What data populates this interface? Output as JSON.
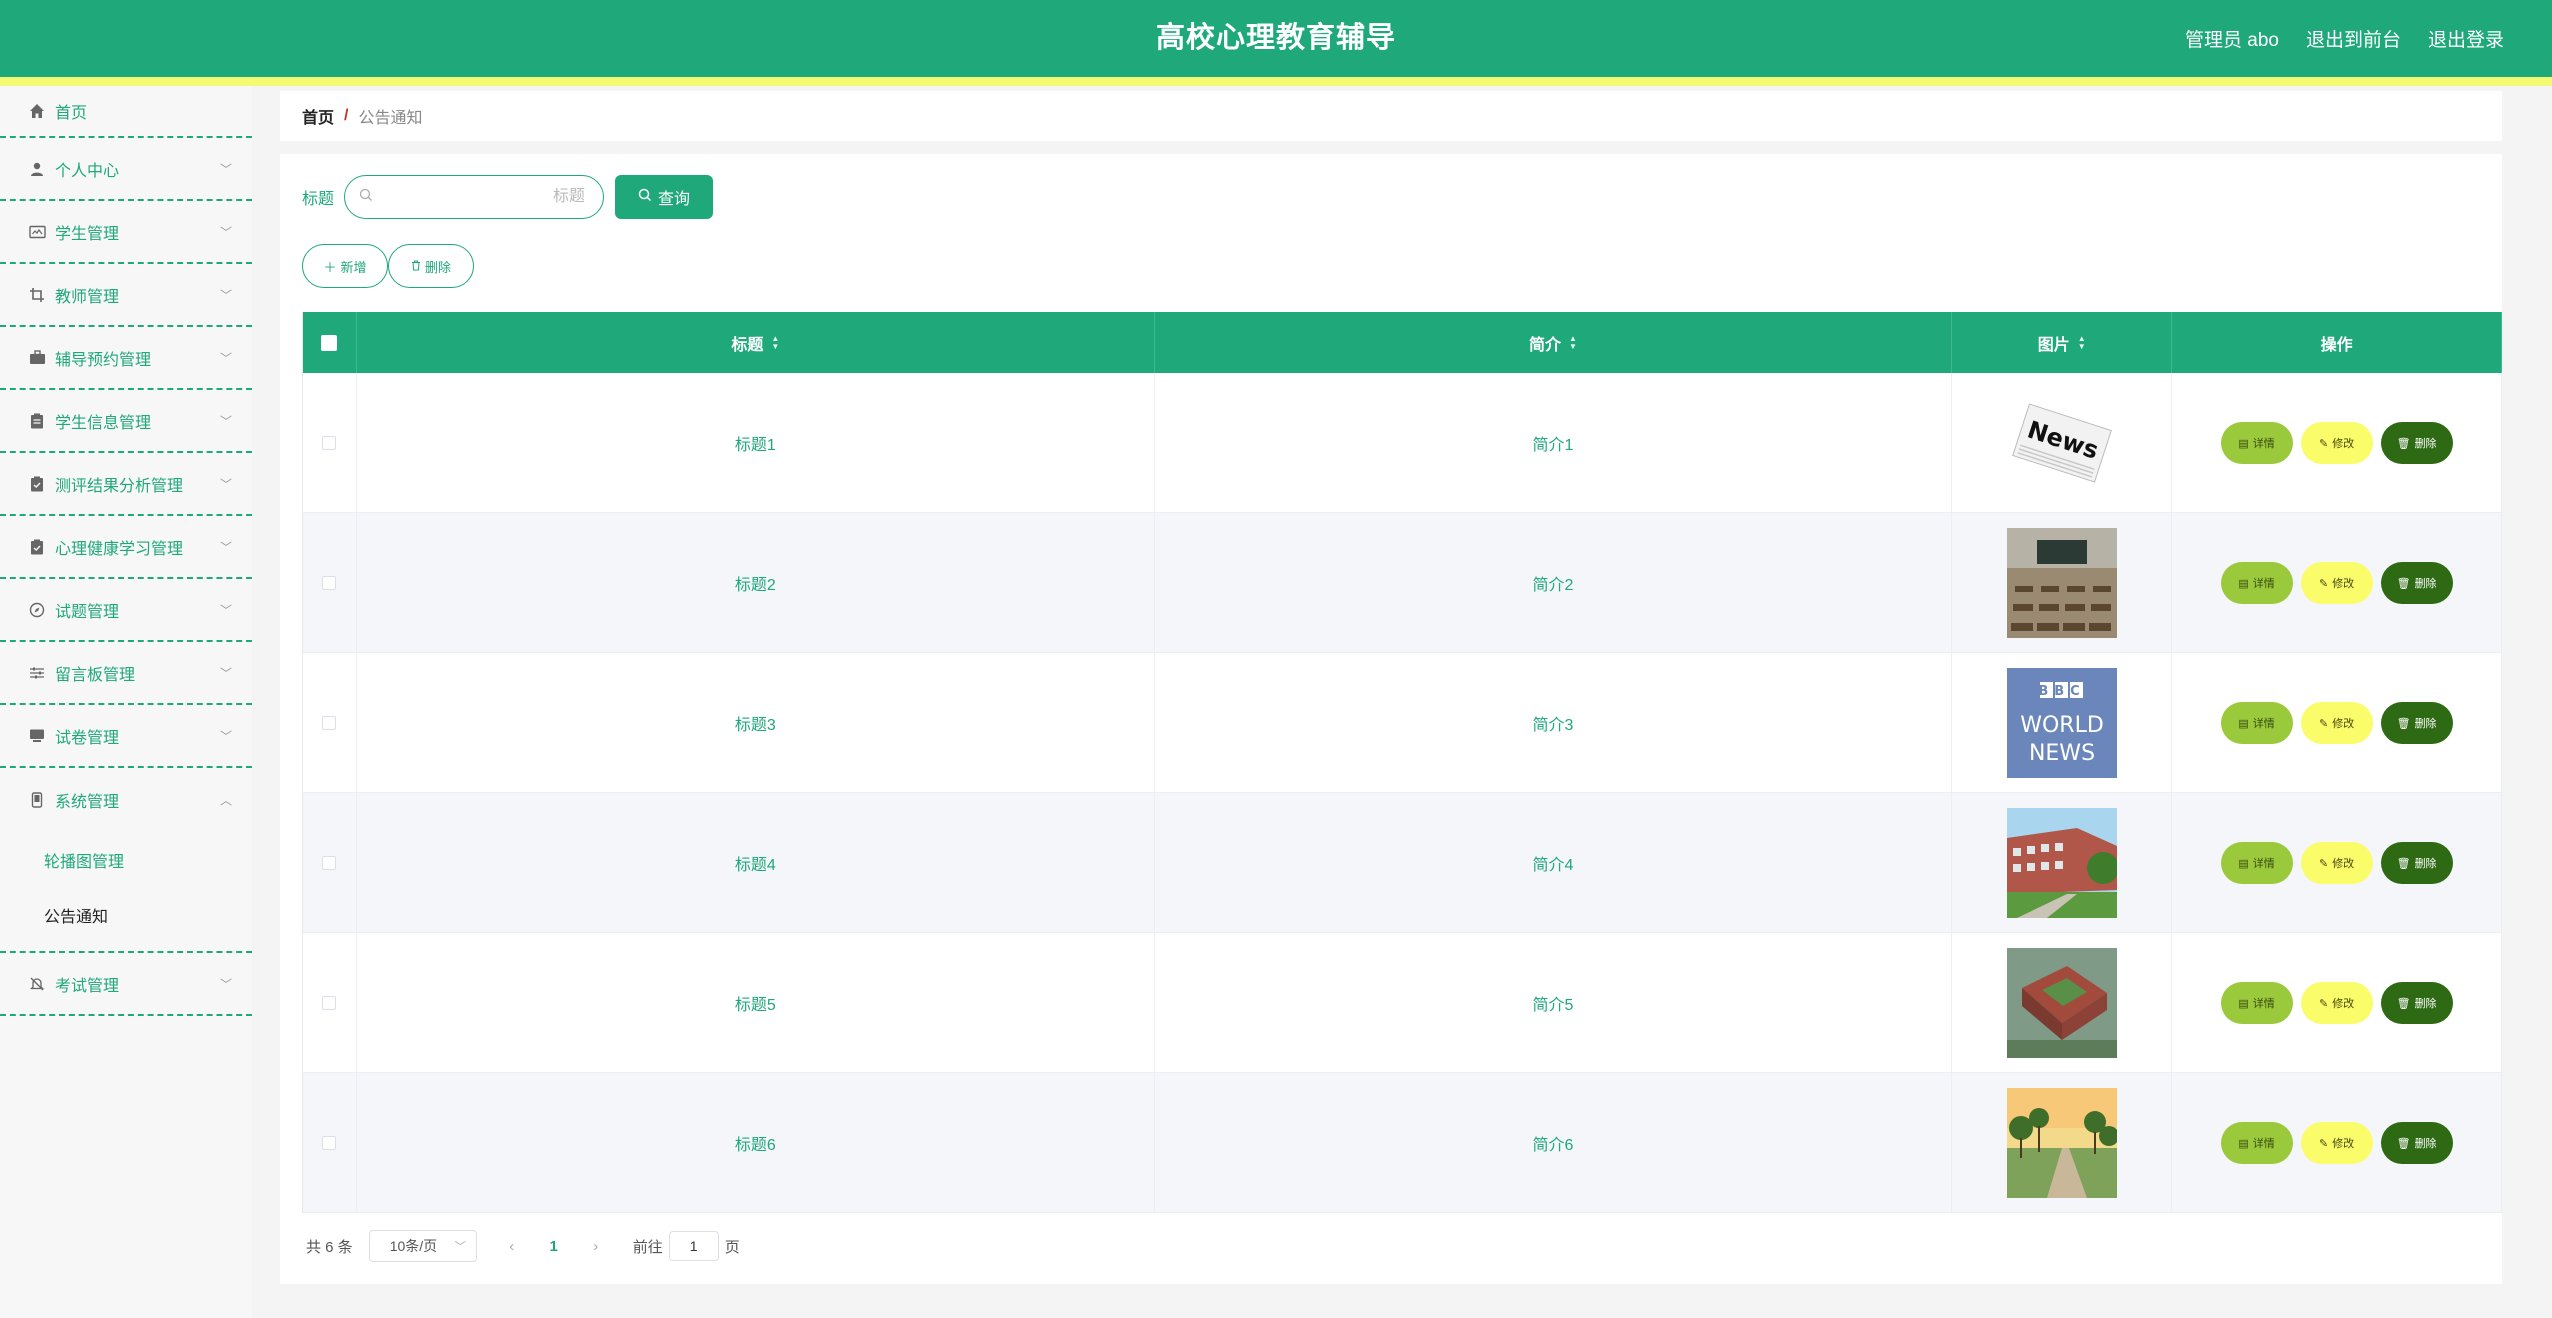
{
  "header": {
    "title": "高校心理教育辅导",
    "admin_label": "管理员 abo",
    "front_label": "退出到前台",
    "logout_label": "退出登录"
  },
  "sidebar": {
    "items": [
      {
        "label": "首页",
        "icon": "home-icon"
      },
      {
        "label": "个人中心",
        "icon": "user-icon"
      },
      {
        "label": "学生管理",
        "icon": "id-card-icon"
      },
      {
        "label": "教师管理",
        "icon": "crop-icon"
      },
      {
        "label": "辅导预约管理",
        "icon": "briefcase-icon"
      },
      {
        "label": "学生信息管理",
        "icon": "clipboard-icon"
      },
      {
        "label": "测评结果分析管理",
        "icon": "clipboard-check-icon"
      },
      {
        "label": "心理健康学习管理",
        "icon": "clipboard-check-icon"
      },
      {
        "label": "试题管理",
        "icon": "compass-icon"
      },
      {
        "label": "留言板管理",
        "icon": "sliders-icon"
      },
      {
        "label": "试卷管理",
        "icon": "monitor-icon"
      },
      {
        "label": "系统管理",
        "icon": "phone-icon"
      },
      {
        "label": "考试管理",
        "icon": "bell-off-icon"
      }
    ],
    "system_sub": [
      "轮播图管理",
      "公告通知"
    ]
  },
  "breadcrumb": {
    "home": "首页",
    "sep": "/",
    "current": "公告通知"
  },
  "search": {
    "label": "标题",
    "placeholder": "标题",
    "value": "",
    "button": "查询"
  },
  "actions": {
    "add": "新增",
    "delete": "删除"
  },
  "table": {
    "columns": [
      "标题",
      "简介",
      "图片",
      "操作"
    ],
    "rows": [
      {
        "title": "标题1",
        "intro": "简介1",
        "image": "news-newspaper"
      },
      {
        "title": "标题2",
        "intro": "简介2",
        "image": "classroom"
      },
      {
        "title": "标题3",
        "intro": "简介3",
        "image": "bbc-world-news"
      },
      {
        "title": "标题4",
        "intro": "简介4",
        "image": "campus-building"
      },
      {
        "title": "标题5",
        "intro": "简介5",
        "image": "campus-aerial"
      },
      {
        "title": "标题6",
        "intro": "简介6",
        "image": "campus-trees"
      }
    ],
    "op_labels": {
      "detail": "详情",
      "edit": "修改",
      "delete": "删除"
    },
    "thumb_text": {
      "news": "News",
      "bbc_1": "BBC",
      "bbc_2": "WORLD",
      "bbc_3": "NEWS"
    }
  },
  "pagination": {
    "total": "共 6 条",
    "page_size": "10条/页",
    "current_page": "1",
    "goto_label": "前往",
    "goto_value": "1",
    "page_suffix": "页"
  },
  "colors": {
    "primary": "#1fa87a",
    "stripe": "#f6fa73",
    "detail": "#9ac93b",
    "edit": "#fafc6a",
    "delete": "#2e6a14"
  }
}
